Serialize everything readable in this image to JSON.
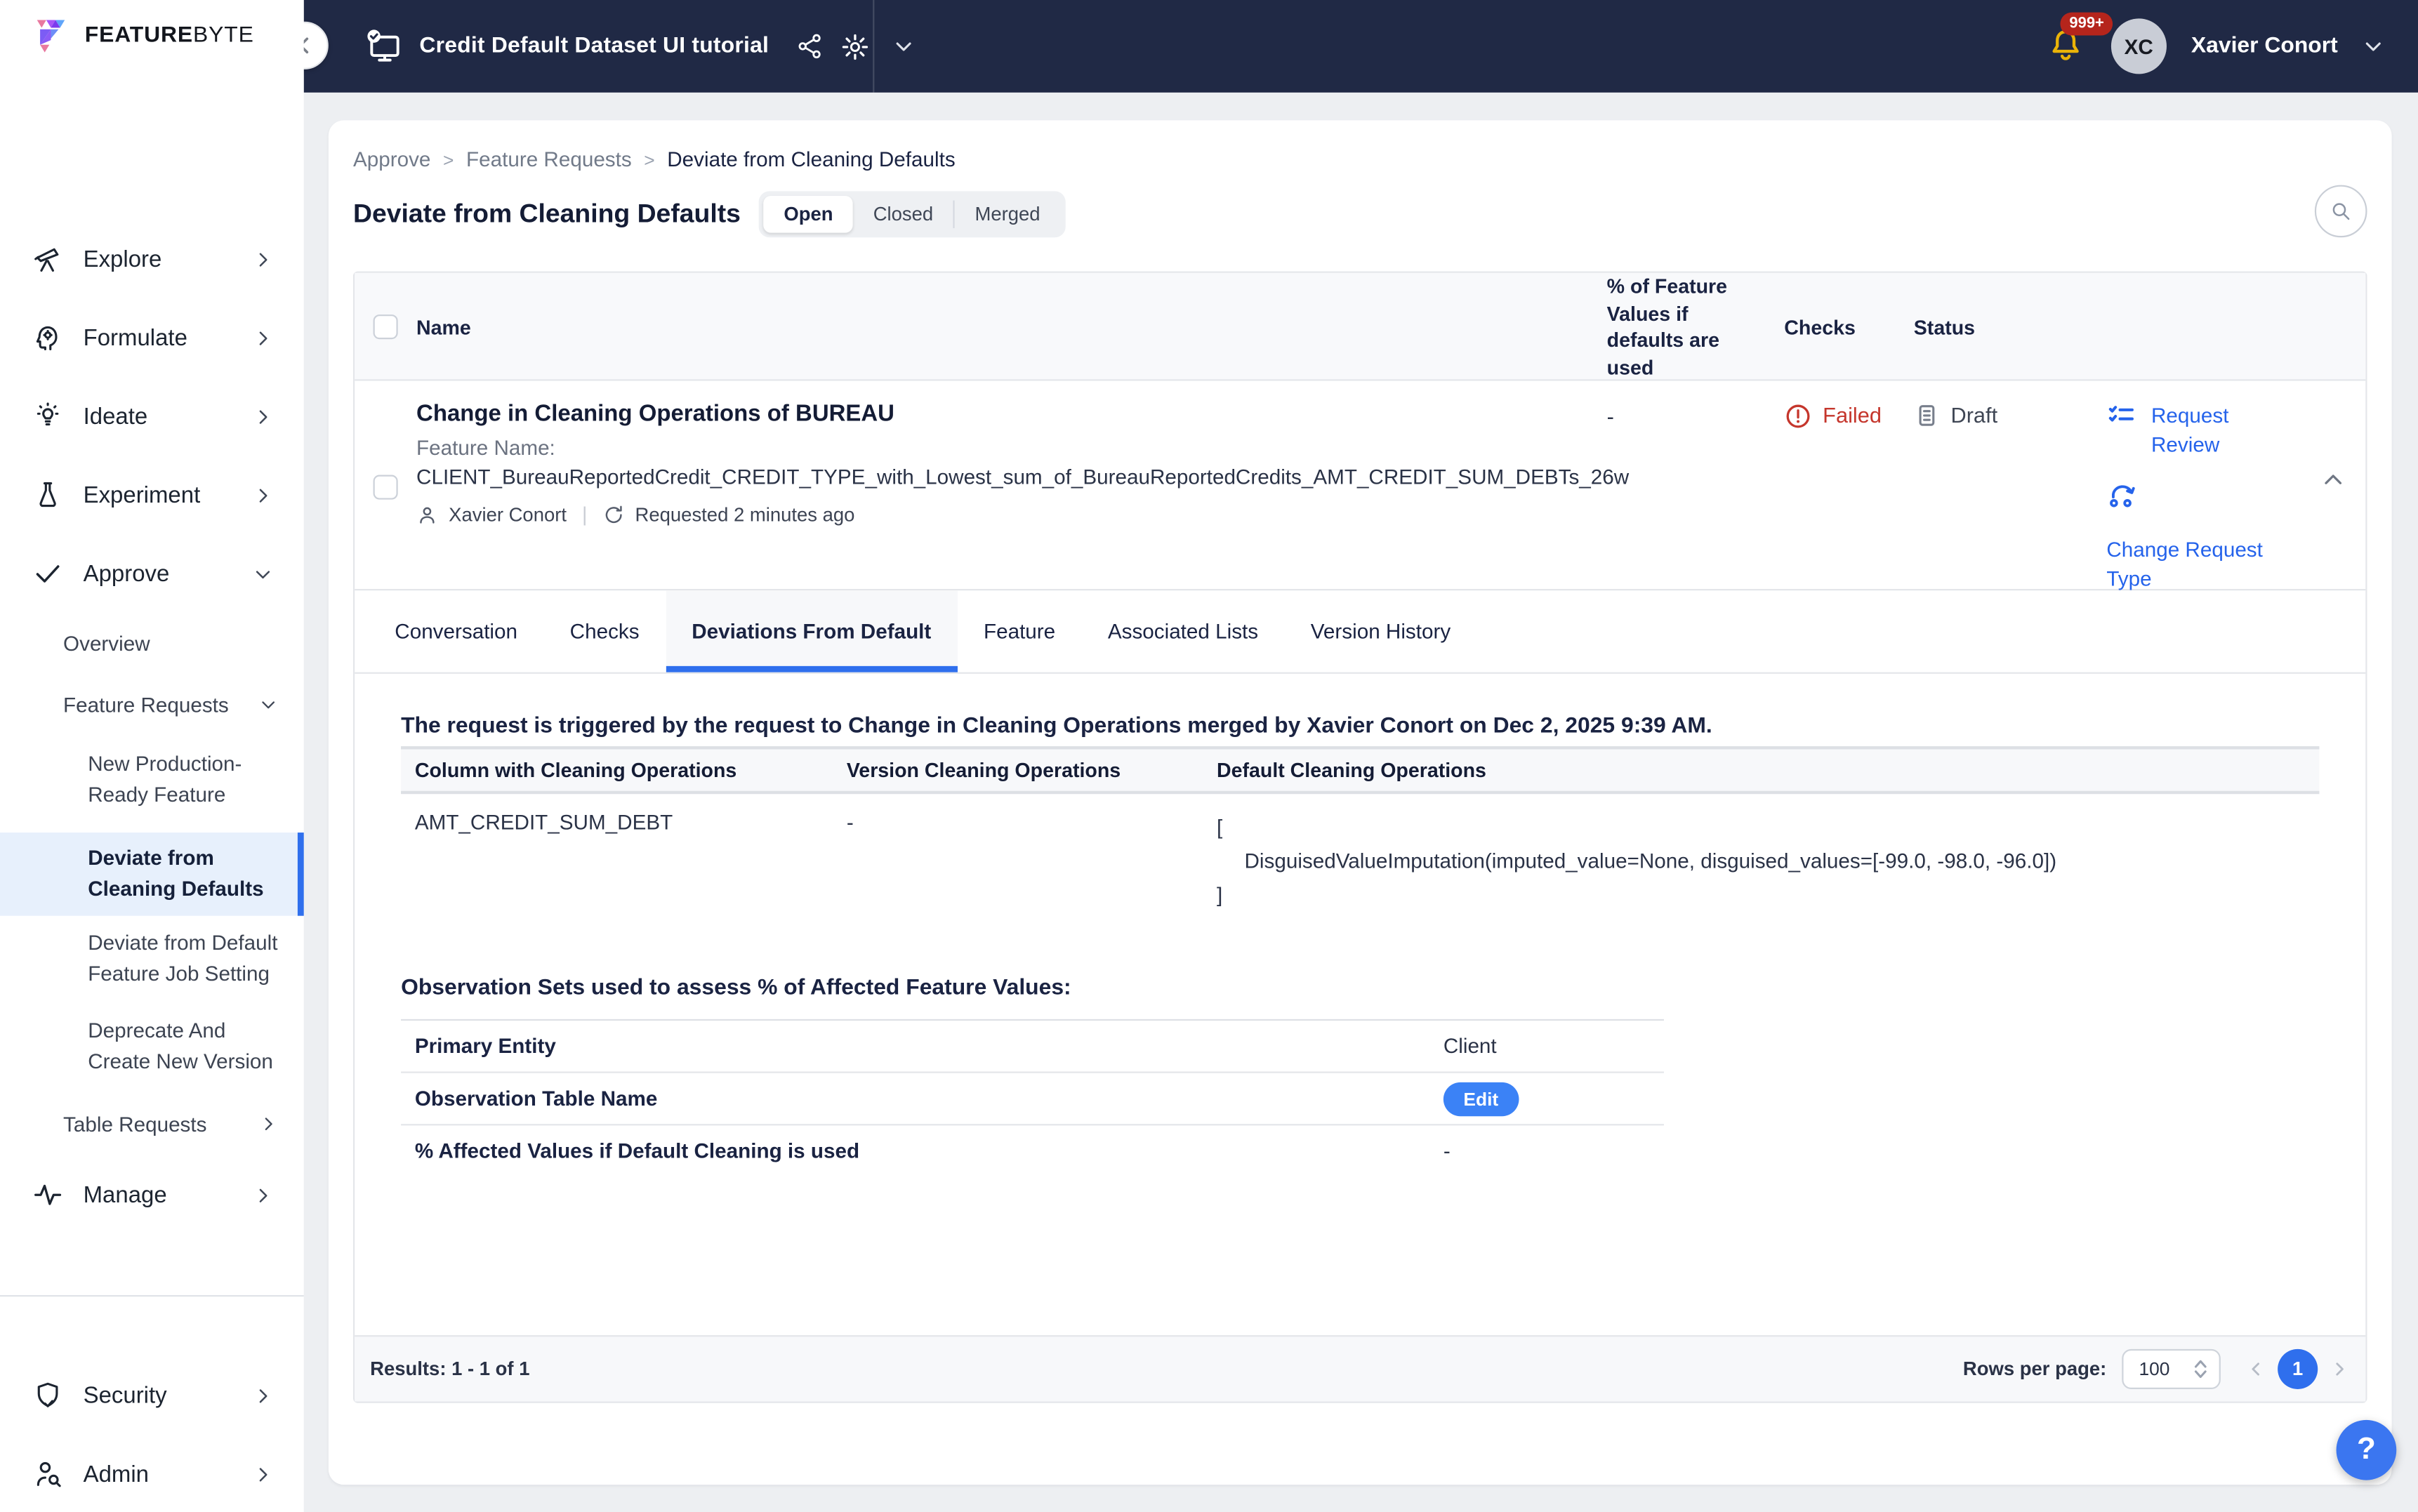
{
  "brand": {
    "feature": "FEATURE",
    "byte": "BYTE"
  },
  "topbar": {
    "project_title": "Credit Default Dataset UI tutorial",
    "notification_count": "999+",
    "user_initials": "XC",
    "user_name": "Xavier Conort"
  },
  "sidebar": {
    "nav": [
      {
        "label": "Explore",
        "icon": "telescope-icon"
      },
      {
        "label": "Formulate",
        "icon": "head-gear-icon"
      },
      {
        "label": "Ideate",
        "icon": "lightbulb-icon"
      },
      {
        "label": "Experiment",
        "icon": "flask-icon"
      },
      {
        "label": "Approve",
        "icon": "check-icon"
      }
    ],
    "approve_children": [
      {
        "label": "Overview"
      },
      {
        "label": "Feature Requests"
      },
      {
        "label": "Table Requests"
      }
    ],
    "feature_request_children": [
      {
        "label": "New Production-Ready Feature"
      },
      {
        "label": "Deviate from Cleaning Defaults",
        "selected": true
      },
      {
        "label": "Deviate from Default Feature Job Setting"
      },
      {
        "label": "Deprecate And Create New Version"
      }
    ],
    "manage": {
      "label": "Manage",
      "icon": "activity-icon"
    },
    "footer_nav": [
      {
        "label": "Security",
        "icon": "shield-icon"
      },
      {
        "label": "Admin",
        "icon": "user-search-icon"
      }
    ]
  },
  "breadcrumb": {
    "items": [
      "Approve",
      "Feature Requests",
      "Deviate from Cleaning Defaults"
    ],
    "separator": ">"
  },
  "page": {
    "title": "Deviate from Cleaning Defaults",
    "status_filters": [
      "Open",
      "Closed",
      "Merged"
    ],
    "selected_filter": "Open"
  },
  "requests_table": {
    "headers": {
      "name": "Name",
      "pct": "% of Feature Values if defaults are used",
      "checks": "Checks",
      "status": "Status"
    },
    "row": {
      "title": "Change in Cleaning Operations of BUREAU",
      "feature_name_label": "Feature Name:",
      "feature_name": "CLIENT_BureauReportedCredit_CREDIT_TYPE_with_Lowest_sum_of_BureauReportedCredits_AMT_CREDIT_SUM_DEBTs_26w",
      "requester": "Xavier Conort",
      "meta_separator": "|",
      "requested": "Requested 2 minutes ago",
      "pct_value": "-",
      "checks_value": "Failed",
      "status_value": "Draft",
      "action_review": "Request Review",
      "action_change_type": "Change Request Type"
    }
  },
  "detail_tabs": {
    "items": [
      "Conversation",
      "Checks",
      "Deviations From Default",
      "Feature",
      "Associated Lists",
      "Version History"
    ],
    "active": "Deviations From Default"
  },
  "deviations": {
    "trigger_text": "The request is triggered by the request to Change in Cleaning Operations merged by Xavier Conort on Dec 2, 2025 9:39 AM.",
    "headers": [
      "Column with Cleaning Operations",
      "Version Cleaning Operations",
      "Default Cleaning Operations"
    ],
    "row": {
      "column": "AMT_CREDIT_SUM_DEBT",
      "version": "-",
      "default_lines": [
        "[",
        "DisguisedValueImputation(imputed_value=None, disguised_values=[-99.0, -98.0, -96.0])",
        "]"
      ]
    },
    "observation_heading": "Observation Sets used to assess % of Affected Feature Values:",
    "observation_rows": [
      {
        "label": "Primary Entity",
        "value": "Client"
      },
      {
        "label": "Observation Table Name",
        "button": "Edit"
      },
      {
        "label": "% Affected Values if Default Cleaning is used",
        "value": "-"
      }
    ]
  },
  "footer": {
    "results": "Results: 1 - 1 of 1",
    "rows_per_page_label": "Rows per page:",
    "rows_per_page_value": "100",
    "page": "1"
  },
  "help": {
    "label": "?"
  },
  "colors": {
    "topbar_navy": "#202945",
    "accent_blue": "#2f6fed",
    "link_blue": "#2563eb",
    "failed_red": "#c5362c",
    "badge_red": "#b5251c",
    "bell_gold": "#eab308",
    "selected_nav_bg": "#e7f0fc",
    "edit_button_blue": "#3b82f6"
  }
}
